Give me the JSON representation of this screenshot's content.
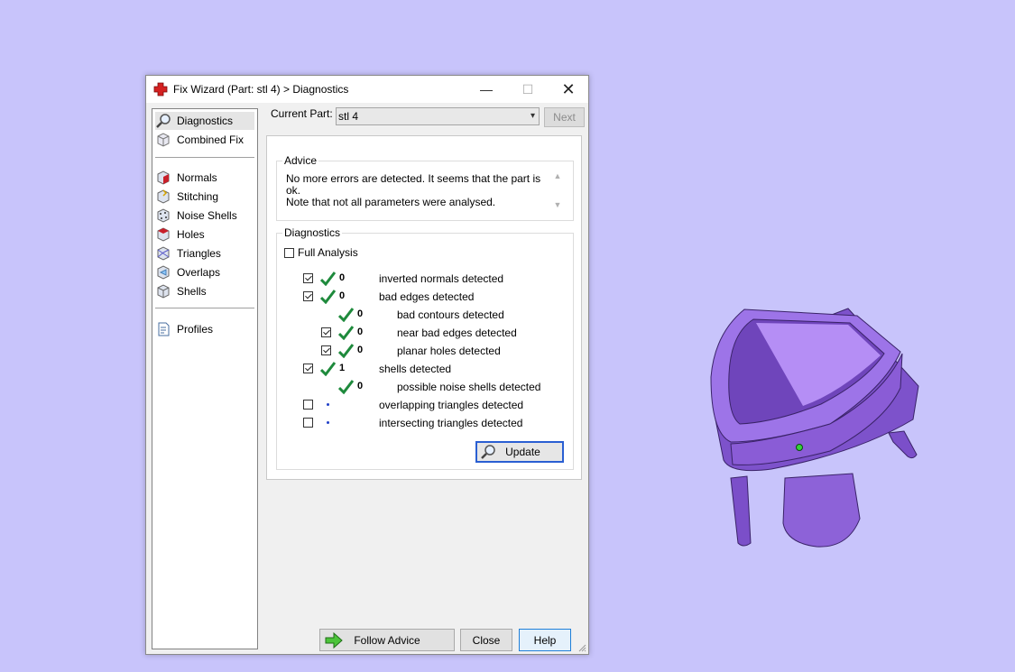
{
  "window": {
    "title": "Fix Wizard (Part: stl 4) > Diagnostics",
    "minimize_glyph": "—",
    "maximize_glyph": "☐",
    "close_glyph": "✕"
  },
  "sidebar": {
    "items": [
      {
        "label": "Diagnostics",
        "icon": "magnifier-icon",
        "selected": true
      },
      {
        "label": "Combined Fix",
        "icon": "combined-fix-icon"
      },
      {
        "label": "Normals",
        "icon": "normals-icon"
      },
      {
        "label": "Stitching",
        "icon": "stitching-icon"
      },
      {
        "label": "Noise Shells",
        "icon": "noise-shells-icon"
      },
      {
        "label": "Holes",
        "icon": "holes-icon"
      },
      {
        "label": "Triangles",
        "icon": "triangles-icon"
      },
      {
        "label": "Overlaps",
        "icon": "overlaps-icon"
      },
      {
        "label": "Shells",
        "icon": "shells-icon"
      },
      {
        "label": "Profiles",
        "icon": "profiles-icon"
      }
    ]
  },
  "current_part": {
    "label": "Current Part:",
    "value": "stl 4",
    "next_label": "Next"
  },
  "advice": {
    "title": "Advice",
    "line1": "No more errors are detected. It seems that the part is ok.",
    "line2": "Note that not all parameters were analysed."
  },
  "diagnostics": {
    "title": "Diagnostics",
    "full_analysis_label": "Full Analysis",
    "full_analysis_checked": false,
    "rows": [
      {
        "checkbox": true,
        "checked": true,
        "status": "ok",
        "count": "0",
        "label": "inverted normals detected"
      },
      {
        "checkbox": true,
        "checked": true,
        "status": "ok",
        "count": "0",
        "label": "bad edges detected"
      },
      {
        "checkbox": false,
        "status": "ok",
        "count": "0",
        "label": "bad contours detected"
      },
      {
        "checkbox": true,
        "checked": true,
        "status": "ok",
        "count": "0",
        "label": "near bad edges detected"
      },
      {
        "checkbox": true,
        "checked": true,
        "status": "ok",
        "count": "0",
        "label": "planar holes detected"
      },
      {
        "checkbox": true,
        "checked": true,
        "status": "ok",
        "count": "1",
        "label": "shells detected"
      },
      {
        "checkbox": false,
        "status": "ok",
        "count": "0",
        "label": "possible noise shells detected"
      },
      {
        "checkbox": true,
        "checked": false,
        "status": "not-analysed",
        "count": "",
        "label": "overlapping triangles detected"
      },
      {
        "checkbox": true,
        "checked": false,
        "status": "not-analysed",
        "count": "",
        "label": "intersecting triangles detected"
      }
    ],
    "update_label": "Update"
  },
  "footer": {
    "follow_advice_label": "Follow Advice",
    "close_label": "Close",
    "help_label": "Help"
  },
  "colors": {
    "desktop_bg": "#c8c4fb",
    "model_purple": "#8a5cd6",
    "check_green": "#1e8a3c",
    "accent_blue": "#2a5fd2"
  }
}
